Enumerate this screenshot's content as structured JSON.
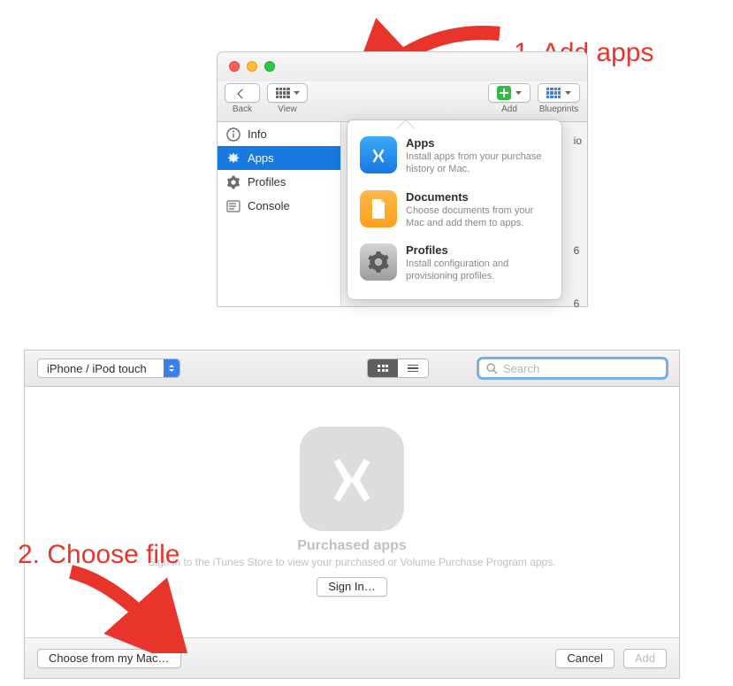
{
  "annotations": {
    "step1": "1. Add apps",
    "step2": "2. Choose file"
  },
  "toolbar": {
    "back_label": "Back",
    "view_label": "View",
    "add_label": "Add",
    "blueprints_label": "Blueprints"
  },
  "sidebar": {
    "items": [
      {
        "label": "Info"
      },
      {
        "label": "Apps"
      },
      {
        "label": "Profiles"
      },
      {
        "label": "Console"
      }
    ]
  },
  "content_peek": {
    "row0": "io",
    "row1": "6",
    "row2": "6"
  },
  "popover": {
    "items": [
      {
        "title": "Apps",
        "desc": "Install apps from your purchase history or Mac."
      },
      {
        "title": "Documents",
        "desc": "Choose documents from your Mac and add them to apps."
      },
      {
        "title": "Profiles",
        "desc": "Install configuration and provisioning profiles."
      }
    ]
  },
  "lower": {
    "device_selector": "iPhone / iPod touch",
    "search_placeholder": "Search",
    "empty_title": "Purchased apps",
    "empty_desc": "Sign in to the iTunes Store to view your purchased or Volume Purchase Program apps.",
    "sign_in": "Sign In…",
    "choose_file": "Choose from my Mac…",
    "cancel": "Cancel",
    "add": "Add"
  }
}
